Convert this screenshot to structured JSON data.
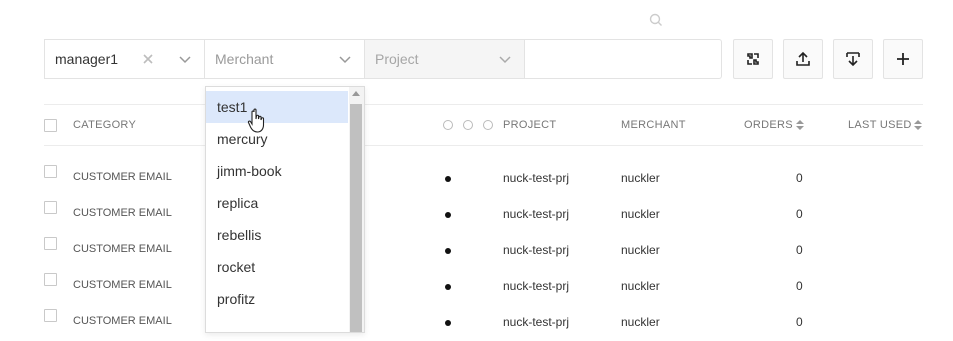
{
  "filters": {
    "manager_value": "manager1",
    "merchant_placeholder": "Merchant",
    "project_placeholder": "Project",
    "search_placeholder": ""
  },
  "toolbar": {
    "buttons": [
      "collapse-icon",
      "upload-icon",
      "download-icon",
      "plus-icon"
    ]
  },
  "table": {
    "headers": {
      "category": "CATEGORY",
      "project": "PROJECT",
      "merchant": "MERCHANT",
      "orders": "ORDERS",
      "last_used": "LAST USED"
    },
    "rows": [
      {
        "category": "CUSTOMER EMAIL",
        "project": "nuck-test-prj",
        "merchant": "nuckler",
        "orders": "0"
      },
      {
        "category": "CUSTOMER EMAIL",
        "project": "nuck-test-prj",
        "merchant": "nuckler",
        "orders": "0"
      },
      {
        "category": "CUSTOMER EMAIL",
        "project": "nuck-test-prj",
        "merchant": "nuckler",
        "orders": "0"
      },
      {
        "category": "CUSTOMER EMAIL",
        "project": "nuck-test-prj",
        "merchant": "nuckler",
        "orders": "0"
      },
      {
        "category": "CUSTOMER EMAIL",
        "project": "nuck-test-prj",
        "merchant": "nuckler",
        "orders": "0"
      }
    ]
  },
  "merchant_dropdown": {
    "options": [
      "test1",
      "mercury",
      "jimm-book",
      "replica",
      "rebellis",
      "rocket",
      "profitz"
    ],
    "selected": "test1"
  },
  "colors": {
    "selected_option_bg": "#dce8fb",
    "border": "#e3e3e3"
  }
}
